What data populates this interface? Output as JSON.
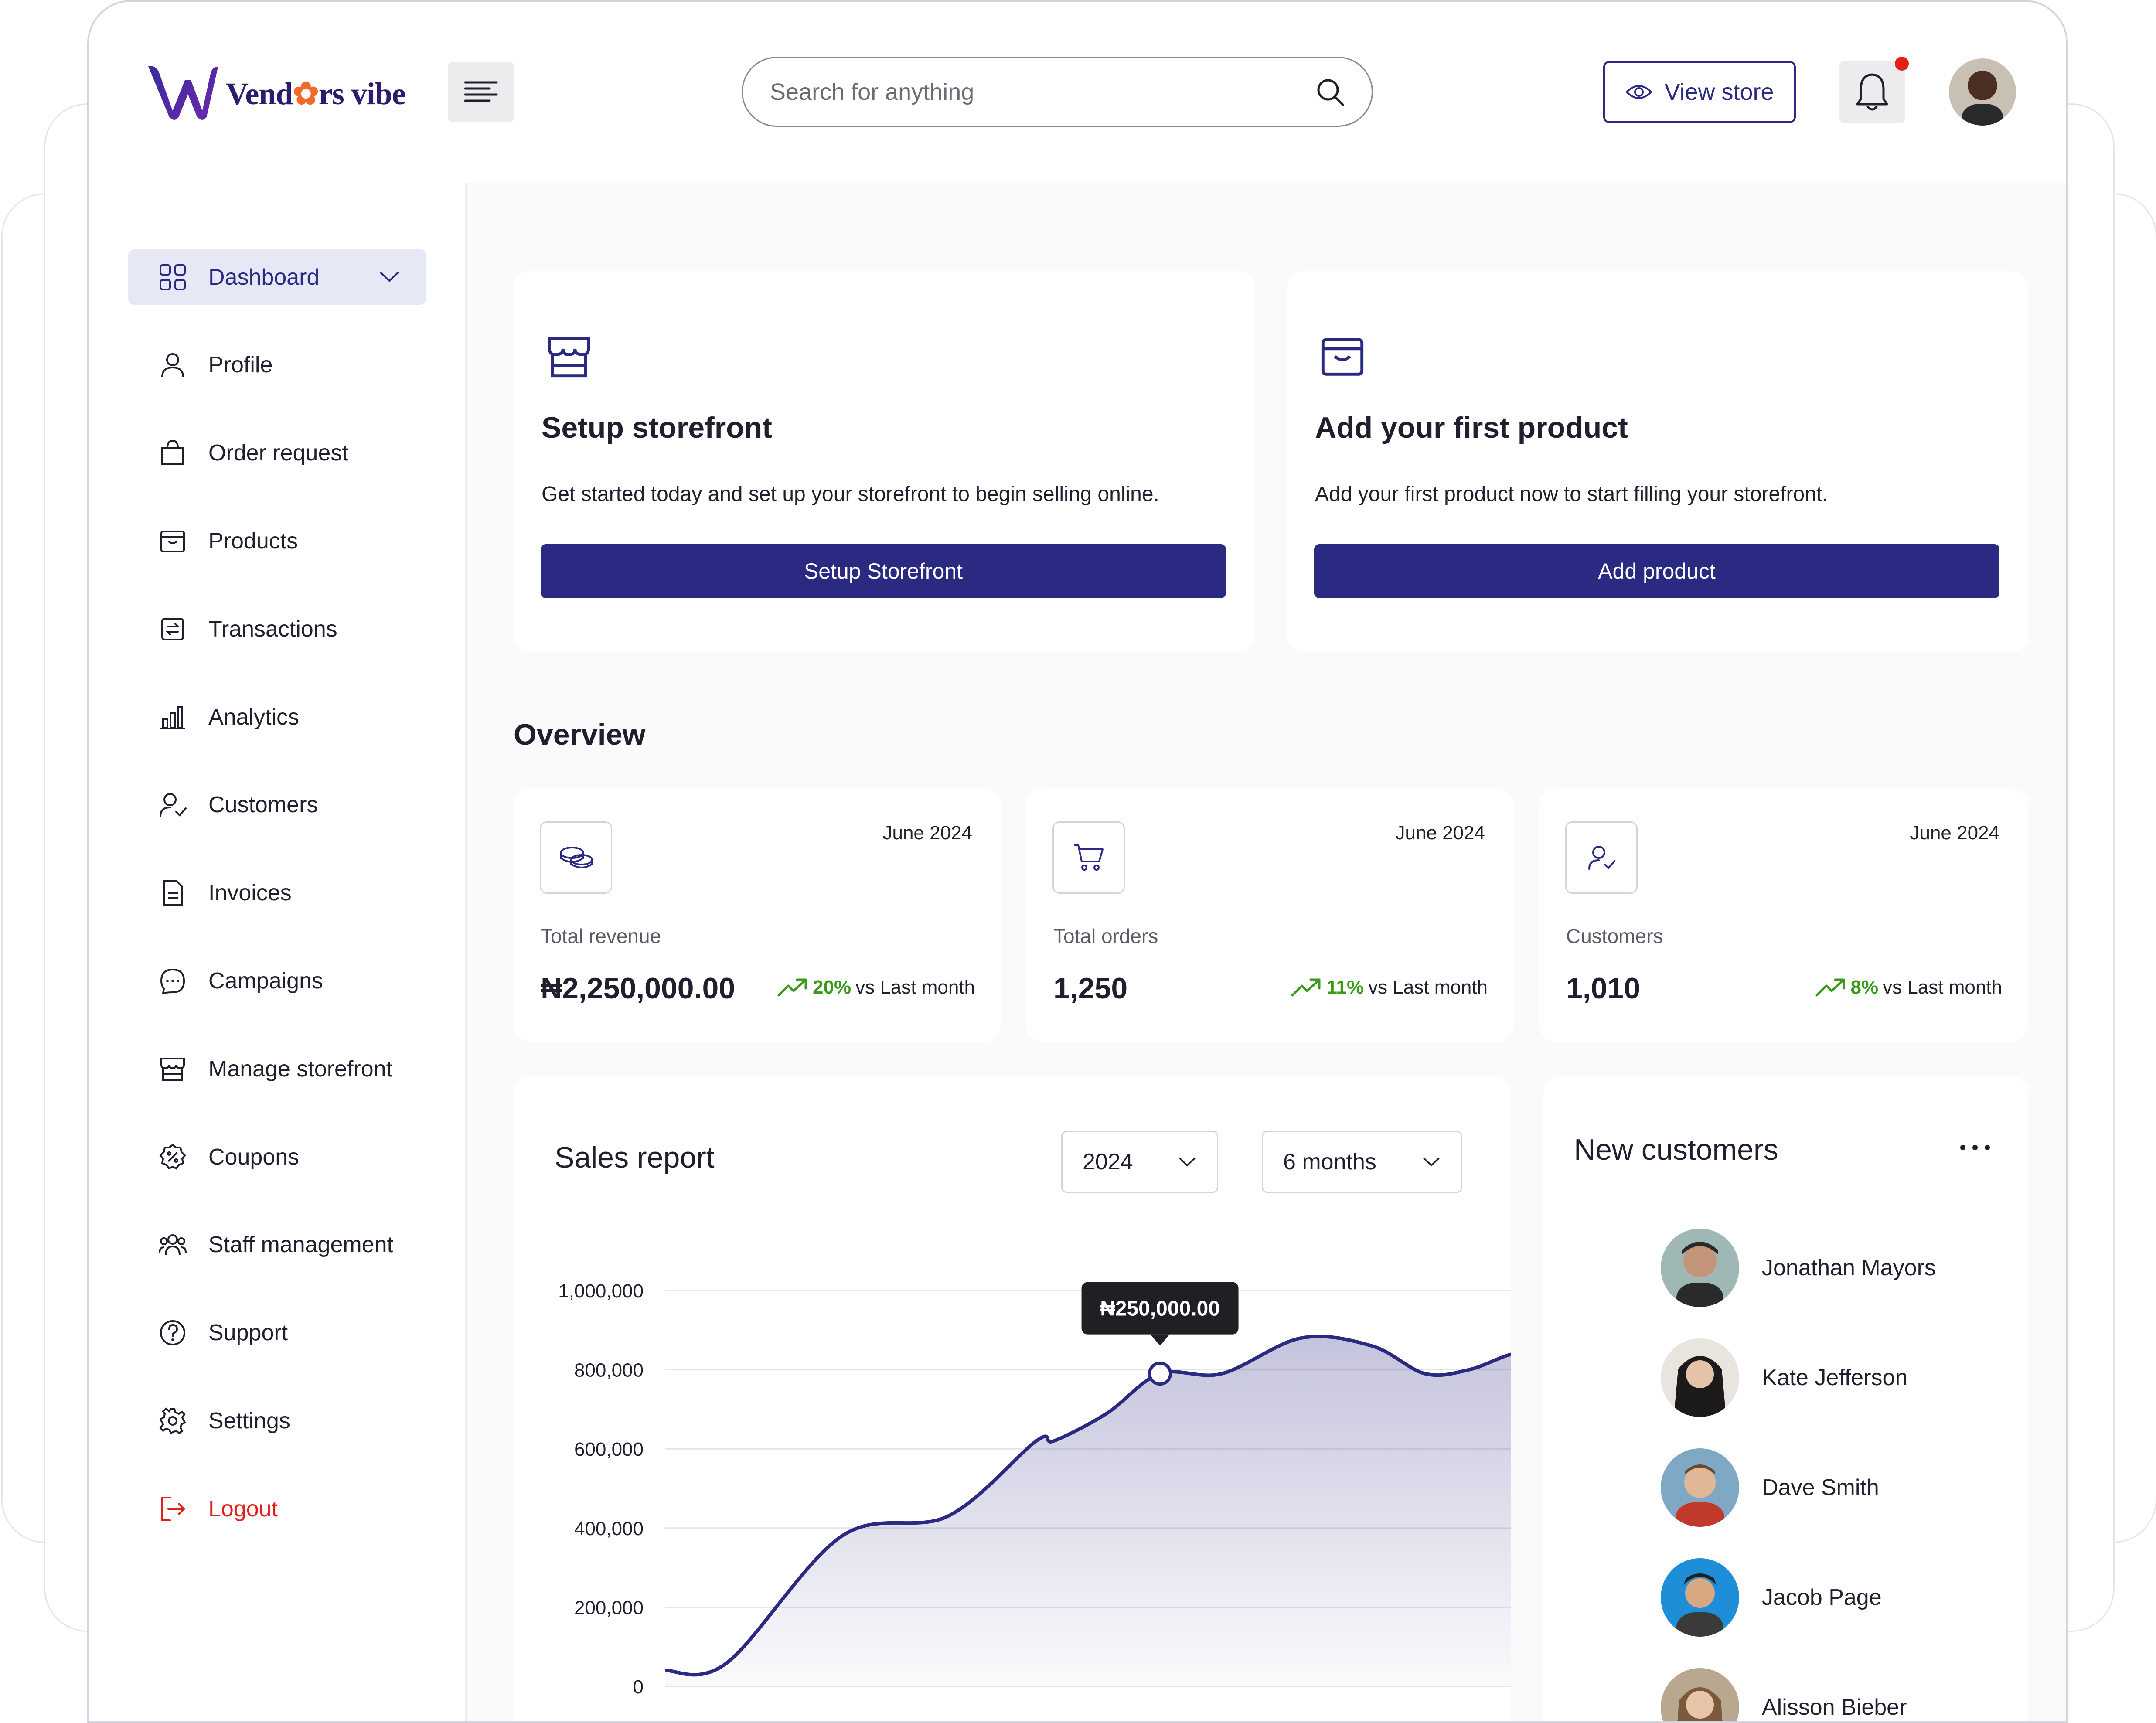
{
  "brand": {
    "name_pre": "Vend",
    "name_post": "rs vibe",
    "accent": "#2b2a83"
  },
  "search": {
    "placeholder": "Search for anything"
  },
  "header": {
    "view_store": "View store"
  },
  "sidebar": {
    "items": [
      {
        "label": "Dashboard",
        "icon": "grid-icon"
      },
      {
        "label": "Profile",
        "icon": "user-icon"
      },
      {
        "label": "Order request",
        "icon": "shopping-bag-icon"
      },
      {
        "label": "Products",
        "icon": "box-icon"
      },
      {
        "label": "Transactions",
        "icon": "transfer-icon"
      },
      {
        "label": "Analytics",
        "icon": "bar-chart-icon"
      },
      {
        "label": "Customers",
        "icon": "customers-icon"
      },
      {
        "label": "Invoices",
        "icon": "document-icon"
      },
      {
        "label": "Campaigns",
        "icon": "chat-icon"
      },
      {
        "label": "Manage storefront",
        "icon": "storefront-icon"
      },
      {
        "label": "Coupons",
        "icon": "coupon-icon"
      },
      {
        "label": "Staff management",
        "icon": "staff-icon"
      },
      {
        "label": "Support",
        "icon": "help-icon"
      },
      {
        "label": "Settings",
        "icon": "gear-icon"
      },
      {
        "label": "Logout",
        "icon": "logout-icon"
      }
    ]
  },
  "setup_cards": [
    {
      "title": "Setup storefront",
      "desc": "Get started today and set up your storefront to begin selling online.",
      "button": "Setup Storefront"
    },
    {
      "title": "Add your first product",
      "desc": "Add your first product now to start filling your storefront.",
      "button": "Add product"
    }
  ],
  "overview": {
    "title": "Overview",
    "stats": [
      {
        "date": "June 2024",
        "label": "Total revenue",
        "value": "₦2,250,000.00",
        "pct": "20%",
        "vs": "vs Last month"
      },
      {
        "date": "June 2024",
        "label": "Total orders",
        "value": "1,250",
        "pct": "11%",
        "vs": "vs Last month"
      },
      {
        "date": "June 2024",
        "label": "Customers",
        "value": "1,010",
        "pct": "8%",
        "vs": "vs Last month"
      }
    ]
  },
  "sales_report": {
    "title": "Sales report",
    "year": "2024",
    "range": "6 months",
    "tooltip": "₦250,000.00"
  },
  "chart_data": {
    "type": "area",
    "title": "Sales report",
    "ylim": [
      0,
      1000000
    ],
    "yticks": [
      "1,000,000",
      "800,000",
      "600,000",
      "400,000",
      "200,000",
      "0"
    ],
    "x": [
      0,
      0.07,
      0.2,
      0.32,
      0.42,
      0.44,
      0.5,
      0.56,
      0.63,
      0.72,
      0.8,
      0.86,
      0.91,
      0.96,
      1.0
    ],
    "y": [
      40000,
      60000,
      380000,
      430000,
      620000,
      620000,
      690000,
      790000,
      790000,
      880000,
      860000,
      790000,
      800000,
      840000,
      840000
    ],
    "highlight": {
      "x": 0.56,
      "y": 790000,
      "label": "₦250,000.00"
    },
    "color": "#2b2a83"
  },
  "new_customers": {
    "title": "New customers",
    "people": [
      "Jonathan Mayors",
      "Kate Jefferson",
      "Dave Smith",
      "Jacob Page",
      "Alisson Bieber"
    ]
  }
}
